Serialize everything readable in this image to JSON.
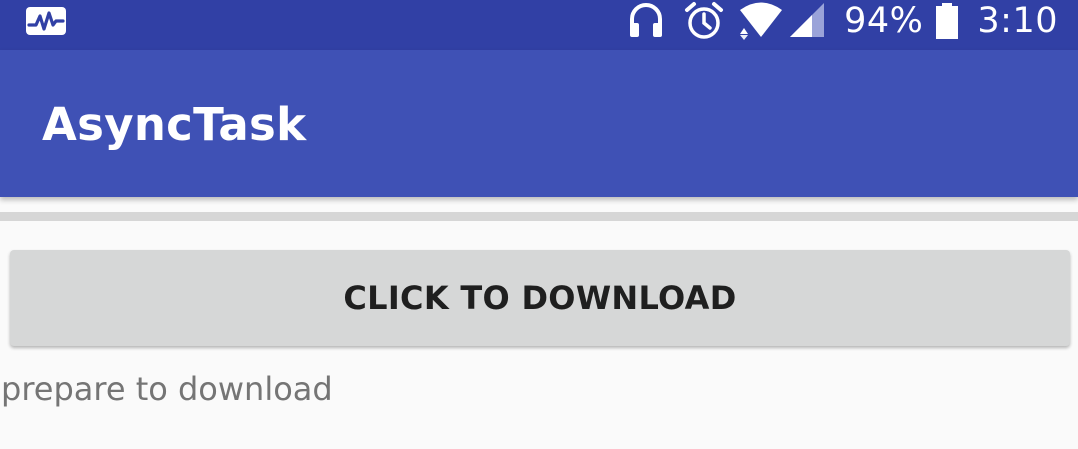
{
  "status_bar": {
    "left_icon": "activity-pulse-icon",
    "icons": [
      "headphones-icon",
      "alarm-clock-icon",
      "wifi-icon",
      "cell-signal-icon",
      "battery-icon"
    ],
    "battery_text": "94%",
    "time": "3:10",
    "color": "#3140a5"
  },
  "app_bar": {
    "title": "AsyncTask",
    "color": "#3f51b5"
  },
  "progress": {
    "value": 0,
    "track_color": "#d6d6d6"
  },
  "button": {
    "label": "CLICK TO DOWNLOAD"
  },
  "status": {
    "message": "prepare to download"
  }
}
